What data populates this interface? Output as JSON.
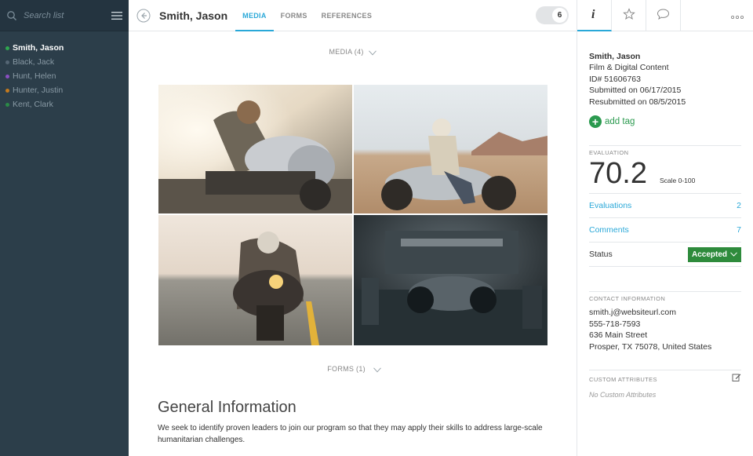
{
  "sidebar": {
    "search_placeholder": "Search list",
    "items": [
      {
        "label": "Smith, Jason",
        "color": "#2fa84f",
        "active": true
      },
      {
        "label": "Black, Jack",
        "color": "#556674",
        "active": false
      },
      {
        "label": "Hunt, Helen",
        "color": "#8a4fc1",
        "active": false
      },
      {
        "label": "Hunter, Justin",
        "color": "#c47a1e",
        "active": false
      },
      {
        "label": "Kent, Clark",
        "color": "#2b8a47",
        "active": false
      }
    ]
  },
  "header": {
    "title": "Smith, Jason",
    "tabs": [
      {
        "label": "MEDIA",
        "active": true
      },
      {
        "label": "FORMS",
        "active": false
      },
      {
        "label": "REFERENCES",
        "active": false
      }
    ],
    "toggle_count": "6"
  },
  "main": {
    "media_toggle": "MEDIA (4)",
    "forms_toggle": "FORMS (1)",
    "section_heading": "General Information",
    "section_text": "We seek to identify proven leaders to join our program so that they may apply their skills to address large-scale humanitarian challenges."
  },
  "right_panel": {
    "tabs": [
      "info-icon",
      "star-icon",
      "comment-icon"
    ],
    "name": "Smith, Jason",
    "category": "Film & Digital Content",
    "id_line": "ID# 51606763",
    "submitted": "Submitted on 06/17/2015",
    "resubmitted": "Resubmitted on 08/5/2015",
    "add_tag": "add tag",
    "evaluation_label": "EVALUATION",
    "score": "70.2",
    "scale": "Scale 0-100",
    "evaluations_label": "Evaluations",
    "evaluations_count": "2",
    "comments_label": "Comments",
    "comments_count": "7",
    "status_label": "Status",
    "status_value": "Accepted",
    "contact_label": "CONTACT INFORMATION",
    "email": "smith.j@websiteurl.com",
    "phone": "555-718-7593",
    "address1": "636 Main Street",
    "address2": "Prosper, TX 75078, United States",
    "custom_label": "CUSTOM ATTRIBUTES",
    "custom_empty": "No Custom Attributes"
  },
  "colors": {
    "accent": "#2aa8d8",
    "sidebar_bg": "#2c3e4a",
    "status_green": "#2e8b3c"
  }
}
